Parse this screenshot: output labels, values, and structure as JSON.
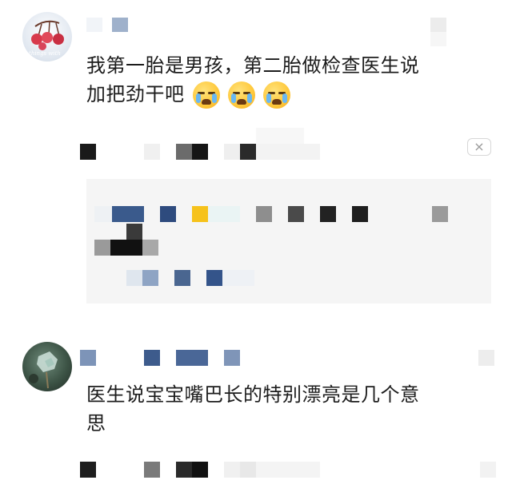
{
  "comments": [
    {
      "text_line1": "我第一胎是男孩，第二胎做检查医生说",
      "text_line2": "加把劲干吧",
      "emojis": [
        "loudly-crying-face-emoji",
        "loudly-crying-face-emoji",
        "loudly-crying-face-emoji"
      ],
      "avatar_caption": "things with",
      "avatar_icon": "cherries-icon"
    },
    {
      "text_line1": "医生说宝宝嘴巴长的特别漂亮是几个意",
      "text_line2": "思",
      "avatar_icon": "plant-photo-icon"
    }
  ],
  "close_label": "×",
  "colors": {
    "reply_bg": "#f5f5f5",
    "text": "#1c1c1c",
    "mosaic_dark": "#1a1a1a",
    "mosaic_navy": "#2f4d7e",
    "mosaic_yellow": "#f6c21b",
    "mosaic_gray": "#8e8e8e"
  }
}
